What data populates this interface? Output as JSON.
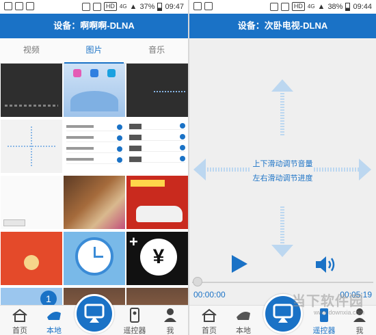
{
  "left": {
    "status": {
      "time": "09:47",
      "battery": "37%",
      "network": "4G",
      "hd": "HD"
    },
    "title": "设备：啊啊啊-DLNA",
    "tabs": [
      {
        "label": "视频",
        "active": false
      },
      {
        "label": "图片",
        "active": true
      },
      {
        "label": "音乐",
        "active": false
      }
    ],
    "nav": [
      {
        "label": "首页",
        "icon": "home-icon",
        "active": false
      },
      {
        "label": "本地",
        "icon": "local-icon",
        "active": true
      },
      {
        "label": "遥控器",
        "icon": "remote-icon",
        "active": false
      },
      {
        "label": "我",
        "icon": "profile-icon",
        "active": false
      }
    ],
    "grid_badge": "1"
  },
  "right": {
    "status": {
      "time": "09:44",
      "battery": "38%",
      "network": "4G",
      "hd": "HD"
    },
    "title": "设备：次卧电视-DLNA",
    "hint_volume": "上下滑动调节音量",
    "hint_progress": "左右滑动调节进度",
    "time_current": "00:00:00",
    "time_total": "00:05:19",
    "nav": [
      {
        "label": "首页",
        "icon": "home-icon",
        "active": false
      },
      {
        "label": "本地",
        "icon": "local-icon",
        "active": false
      },
      {
        "label": "遥控器",
        "icon": "remote-icon",
        "active": true
      },
      {
        "label": "我",
        "icon": "profile-icon",
        "active": false
      }
    ],
    "watermark": "当下软件园",
    "watermark_url": "www.downxia.com"
  },
  "colors": {
    "accent": "#1a72c6",
    "arrow": "#bcd7f0"
  }
}
